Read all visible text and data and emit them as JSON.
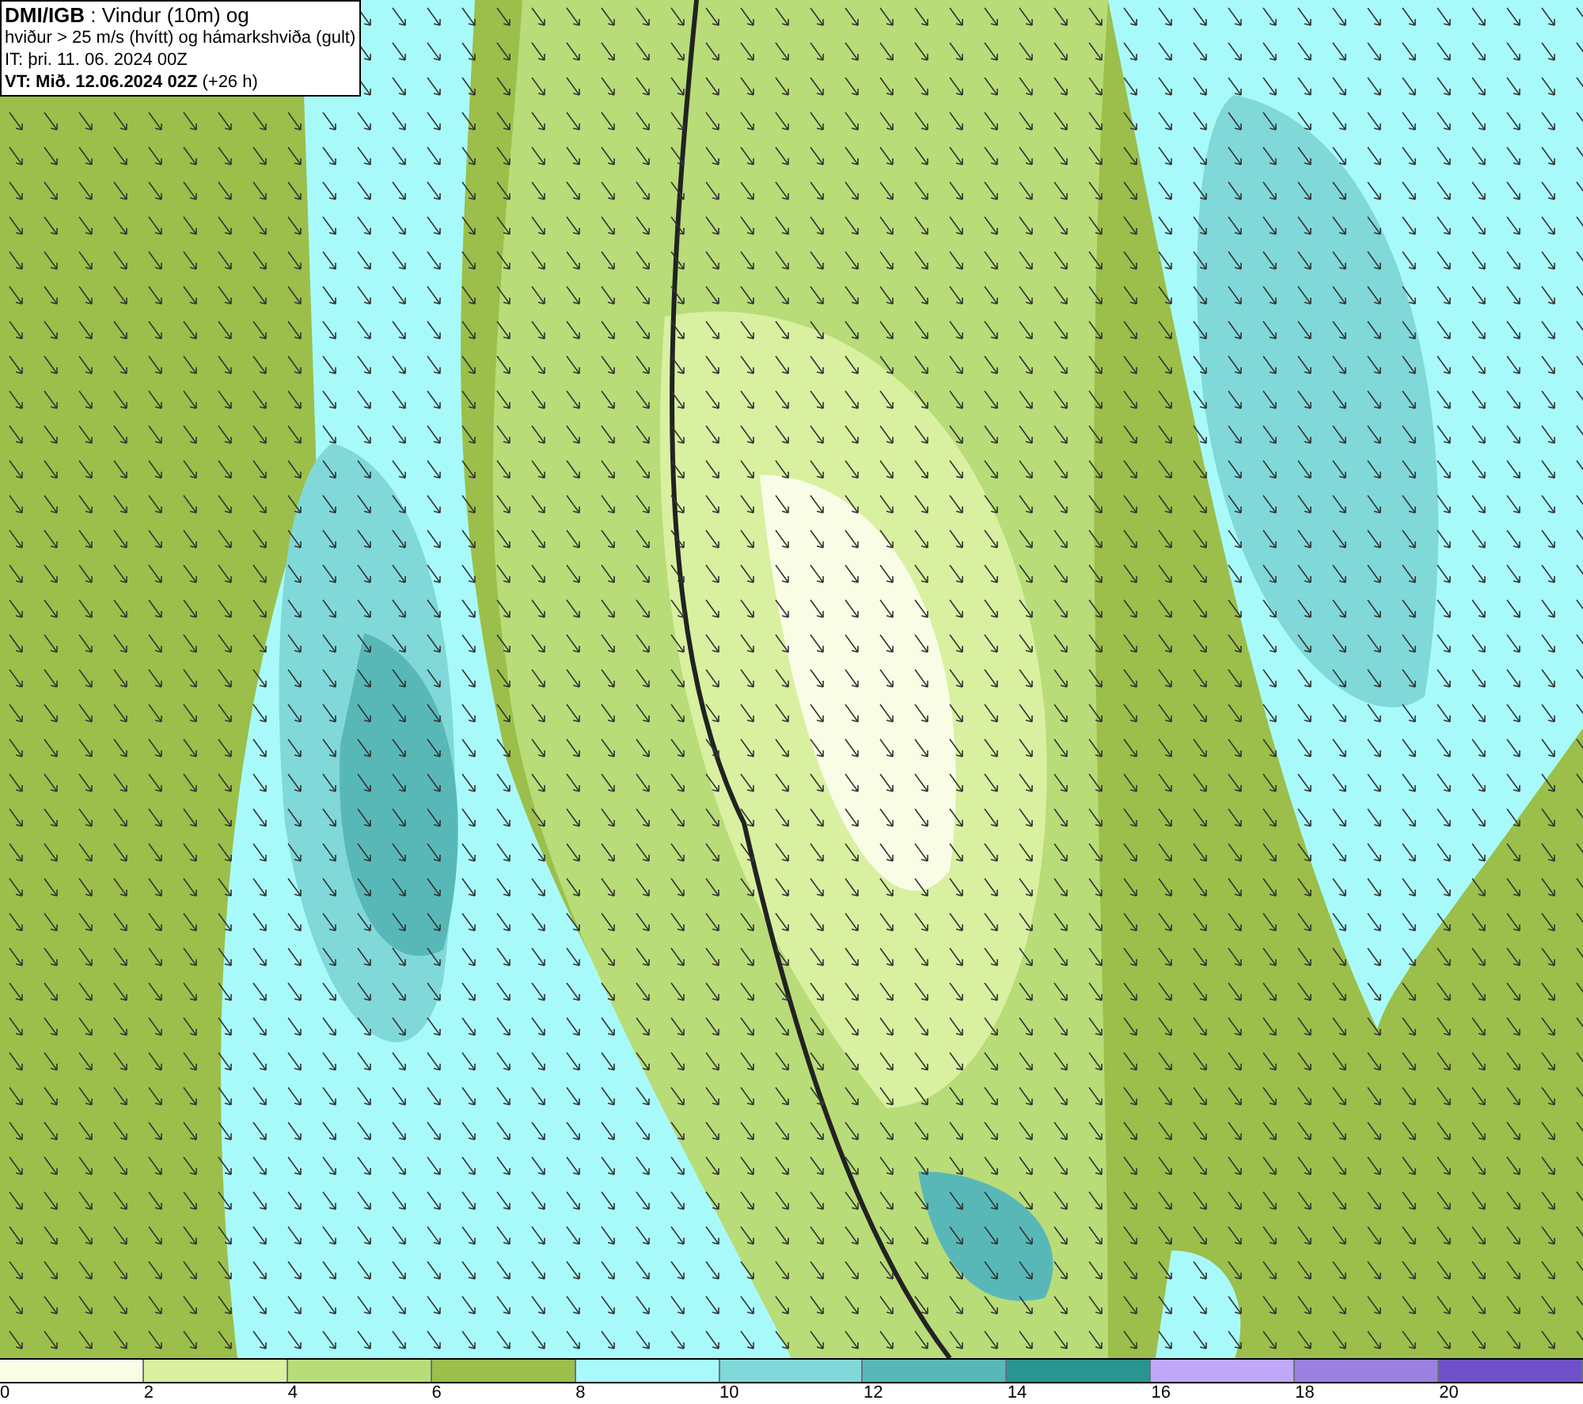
{
  "title_box": {
    "lines": [
      "**DMI/IGB** : Vindur (10m) og",
      "hviður > 25 m/s (hvítt) og hámarkshviða (gult)",
      "IT: þri. 11. 06. 2024 00Z",
      "**VT: Mið. 12.06.2024 02Z** (+26 h)"
    ]
  },
  "legend": {
    "segments": [
      {
        "color": "#fafde6"
      },
      {
        "color": "#d8f0a0"
      },
      {
        "color": "#b8dc78"
      },
      {
        "color": "#9bbf4a"
      },
      {
        "color": "#a8fafa"
      },
      {
        "color": "#80d8d8"
      },
      {
        "color": "#58b8b8"
      },
      {
        "color": "#2a9490"
      },
      {
        "color": "#c0a8f8"
      },
      {
        "color": "#9c80e0"
      },
      {
        "color": "#7050c8"
      }
    ],
    "ticks": [
      "0",
      "2",
      "4",
      "6",
      "8",
      "10",
      "12",
      "14",
      "16",
      "18",
      "20"
    ]
  }
}
